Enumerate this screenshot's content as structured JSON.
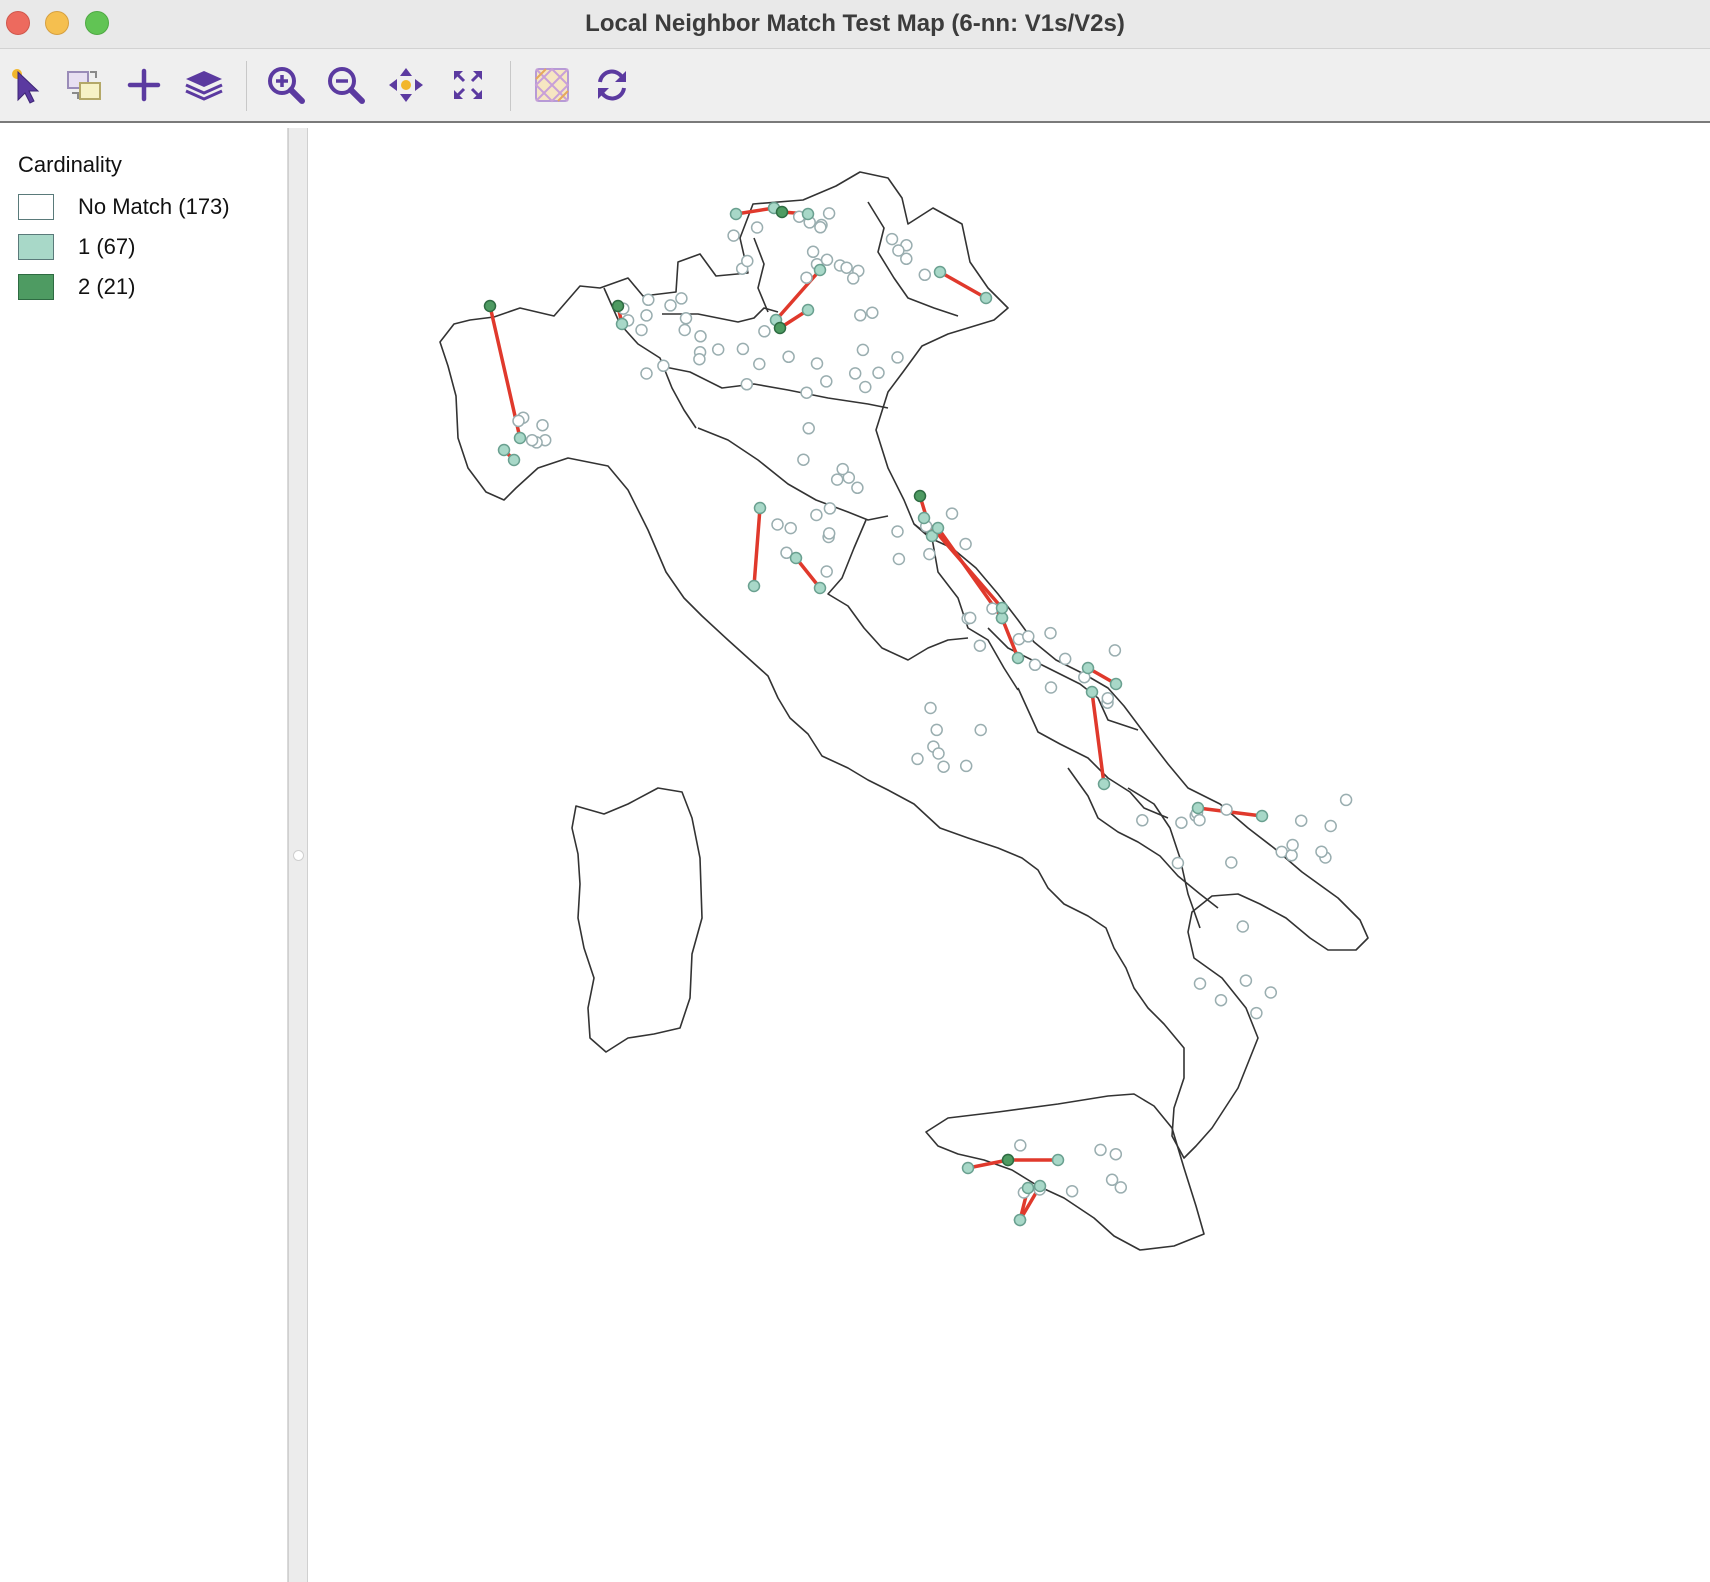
{
  "window": {
    "title": "Local Neighbor Match Test Map (6-nn: V1s/V2s)",
    "controls": [
      "close",
      "minimize",
      "zoom"
    ]
  },
  "toolbar": {
    "buttons": [
      {
        "name": "select-tool-icon",
        "label": "Select"
      },
      {
        "name": "selection-shape-icon",
        "label": "Selection Shape"
      },
      {
        "name": "add-layer-icon",
        "label": "Add Layer"
      },
      {
        "name": "layers-icon",
        "label": "Layers"
      },
      {
        "name": "zoom-in-icon",
        "label": "Zoom In"
      },
      {
        "name": "zoom-out-icon",
        "label": "Zoom Out"
      },
      {
        "name": "pan-icon",
        "label": "Pan"
      },
      {
        "name": "full-extent-icon",
        "label": "Full Extent"
      },
      {
        "name": "basemap-icon",
        "label": "Basemap"
      },
      {
        "name": "refresh-icon",
        "label": "Refresh"
      }
    ]
  },
  "legend": {
    "title": "Cardinality",
    "items": [
      {
        "label": "No Match (173)",
        "color": "#ffffff",
        "border": "#5a7a7a"
      },
      {
        "label": "1 (67)",
        "color": "#a8d8c8",
        "border": "#5a7a7a"
      },
      {
        "label": "2 (21)",
        "color": "#4e9b62",
        "border": "#2e6b42"
      }
    ]
  },
  "map": {
    "colors": {
      "boundary": "#333333",
      "link": "#e0392c",
      "nomatch_stroke": "#9aaeb0",
      "match1_fill": "#a8d8c8",
      "match1_stroke": "#6aa090",
      "match2_fill": "#4e9b62",
      "match2_stroke": "#2e6b42"
    }
  }
}
